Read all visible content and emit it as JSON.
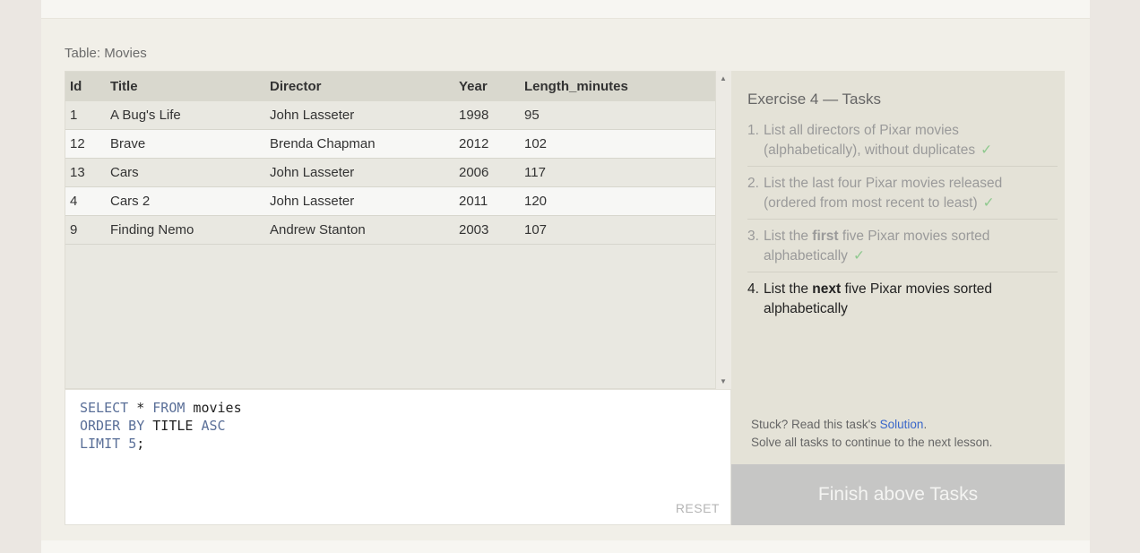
{
  "table_caption": "Table: Movies",
  "table": {
    "columns": [
      "Id",
      "Title",
      "Director",
      "Year",
      "Length_minutes"
    ],
    "rows": [
      [
        "1",
        "A Bug's Life",
        "John Lasseter",
        "1998",
        "95"
      ],
      [
        "12",
        "Brave",
        "Brenda Chapman",
        "2012",
        "102"
      ],
      [
        "13",
        "Cars",
        "John Lasseter",
        "2006",
        "117"
      ],
      [
        "4",
        "Cars 2",
        "John Lasseter",
        "2011",
        "120"
      ],
      [
        "9",
        "Finding Nemo",
        "Andrew Stanton",
        "2003",
        "107"
      ]
    ]
  },
  "editor": {
    "lines": [
      {
        "kw1": "SELECT",
        "t1": " * ",
        "kw2": "FROM",
        "t2": " movies"
      },
      {
        "kw1": "ORDER BY",
        "t1": " TITLE ",
        "kw2": "ASC",
        "t2": ""
      },
      {
        "kw1": "LIMIT",
        "t1": " ",
        "kw2": "5",
        "t2": ";"
      }
    ],
    "reset_label": "RESET"
  },
  "tasks": {
    "title": "Exercise 4 — Tasks",
    "items": [
      {
        "num": "1.",
        "pre": "List all directors of Pixar movies (alphabetically), without duplicates",
        "bold": "",
        "post": "",
        "check": "✓"
      },
      {
        "num": "2.",
        "pre": "List the last four Pixar movies released (ordered from most recent to least)",
        "bold": "",
        "post": "",
        "check": "✓"
      },
      {
        "num": "3.",
        "pre": "List the ",
        "bold": "first",
        "post": " five Pixar movies sorted alphabetically",
        "check": "✓"
      },
      {
        "num": "4.",
        "pre": "List the ",
        "bold": "next",
        "post": " five Pixar movies sorted alphabetically",
        "check": ""
      }
    ],
    "hint_prefix": "Stuck? Read this task's ",
    "hint_link": "Solution",
    "hint_suffix": ".",
    "hint_line2": "Solve all tasks to continue to the next lesson."
  },
  "finish_button": "Finish above Tasks",
  "scroll_up_icon": "▲",
  "scroll_down_icon": "▼"
}
